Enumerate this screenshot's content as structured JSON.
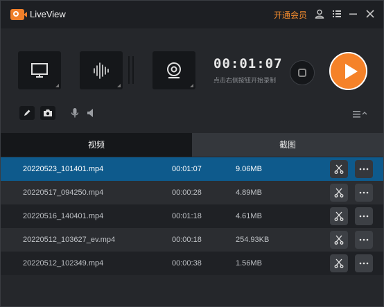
{
  "app": {
    "title": "LiveView",
    "vip_label": "开通会员"
  },
  "recorder": {
    "timer": "00:01:07",
    "hint": "点击右侧按钮开始录制"
  },
  "tabs": [
    {
      "label": "视频"
    },
    {
      "label": "截图"
    }
  ],
  "files": [
    {
      "name": "20220523_101401.mp4",
      "duration": "00:01:07",
      "size": "9.06MB"
    },
    {
      "name": "20220517_094250.mp4",
      "duration": "00:00:28",
      "size": "4.89MB"
    },
    {
      "name": "20220516_140401.mp4",
      "duration": "00:01:18",
      "size": "4.61MB"
    },
    {
      "name": "20220512_103627_ev.mp4",
      "duration": "00:00:18",
      "size": "254.93KB"
    },
    {
      "name": "20220512_102349.mp4",
      "duration": "00:00:38",
      "size": "1.56MB"
    }
  ],
  "colors": {
    "accent": "#f58229",
    "selected_row": "#0e5a8c",
    "vip": "#f08a2e"
  }
}
